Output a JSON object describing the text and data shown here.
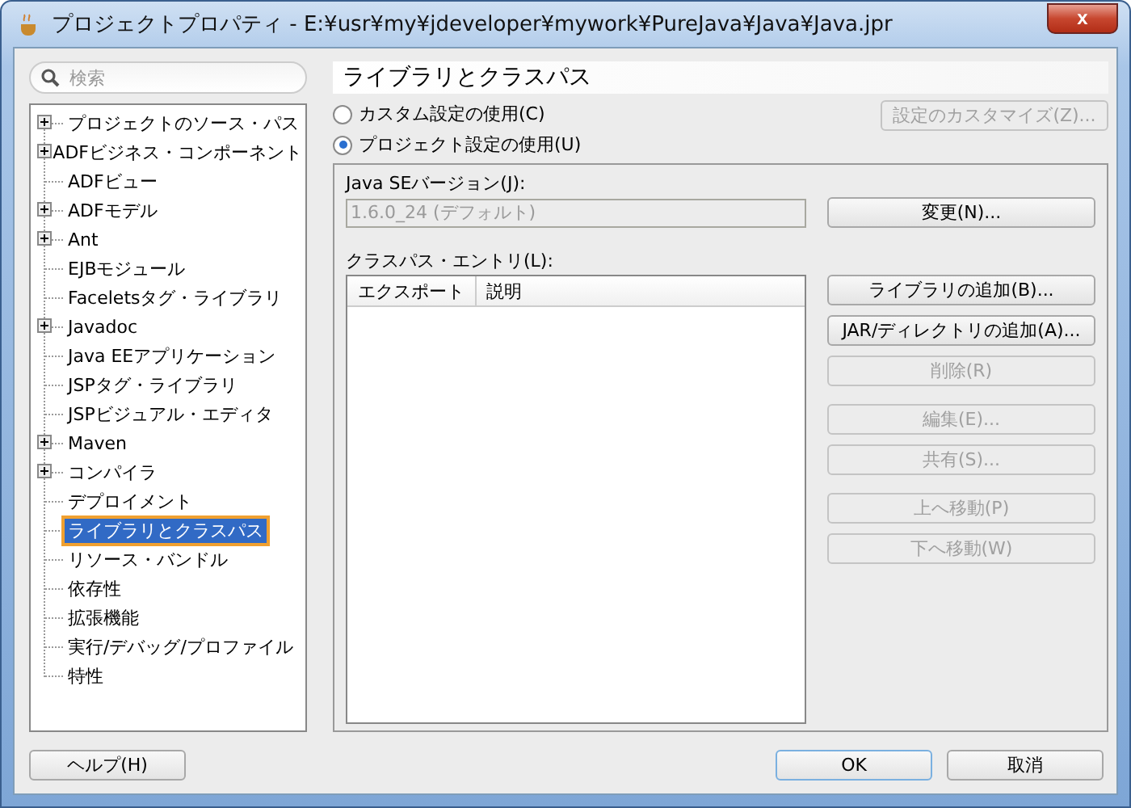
{
  "window": {
    "title": "プロジェクトプロパティ - E:¥usr¥my¥jdeveloper¥mywork¥PureJava¥Java¥Java.jpr",
    "close": "x"
  },
  "search": {
    "placeholder": "検索"
  },
  "tree": [
    {
      "label": "プロジェクトのソース・パス",
      "expandable": true,
      "selected": false
    },
    {
      "label": "ADFビジネス・コンポーネント",
      "expandable": true,
      "selected": false
    },
    {
      "label": "ADFビュー",
      "expandable": false,
      "selected": false
    },
    {
      "label": "ADFモデル",
      "expandable": true,
      "selected": false
    },
    {
      "label": "Ant",
      "expandable": true,
      "selected": false
    },
    {
      "label": "EJBモジュール",
      "expandable": false,
      "selected": false
    },
    {
      "label": "Faceletsタグ・ライブラリ",
      "expandable": false,
      "selected": false
    },
    {
      "label": "Javadoc",
      "expandable": true,
      "selected": false
    },
    {
      "label": "Java EEアプリケーション",
      "expandable": false,
      "selected": false
    },
    {
      "label": "JSPタグ・ライブラリ",
      "expandable": false,
      "selected": false
    },
    {
      "label": "JSPビジュアル・エディタ",
      "expandable": false,
      "selected": false
    },
    {
      "label": "Maven",
      "expandable": true,
      "selected": false
    },
    {
      "label": "コンパイラ",
      "expandable": true,
      "selected": false
    },
    {
      "label": "デプロイメント",
      "expandable": false,
      "selected": false
    },
    {
      "label": "ライブラリとクラスパス",
      "expandable": false,
      "selected": true
    },
    {
      "label": "リソース・バンドル",
      "expandable": false,
      "selected": false
    },
    {
      "label": "依存性",
      "expandable": false,
      "selected": false
    },
    {
      "label": "拡張機能",
      "expandable": false,
      "selected": false
    },
    {
      "label": "実行/デバッグ/プロファイル",
      "expandable": false,
      "selected": false
    },
    {
      "label": "特性",
      "expandable": false,
      "selected": false
    }
  ],
  "panel": {
    "title": "ライブラリとクラスパス",
    "options": [
      {
        "label": "カスタム設定の使用(C)",
        "selected": false
      },
      {
        "label": "プロジェクト設定の使用(U)",
        "selected": true
      }
    ],
    "customize_button": {
      "label": "設定のカスタマイズ(Z)...",
      "disabled": true
    },
    "java_version": {
      "label": "Java SEバージョン(J):",
      "value": "1.6.0_24 (デフォルト)",
      "disabled": true
    },
    "change_button": {
      "label": "変更(N)...",
      "disabled": false
    },
    "classpath": {
      "label": "クラスパス・エントリ(L):",
      "columns": [
        "エクスポート",
        "説明"
      ]
    },
    "button_groups": [
      [
        {
          "label": "ライブラリの追加(B)...",
          "disabled": false
        },
        {
          "label": "JAR/ディレクトリの追加(A)...",
          "disabled": false
        },
        {
          "label": "削除(R)",
          "disabled": true
        }
      ],
      [
        {
          "label": "編集(E)...",
          "disabled": true
        },
        {
          "label": "共有(S)...",
          "disabled": true
        }
      ],
      [
        {
          "label": "上へ移動(P)",
          "disabled": true
        },
        {
          "label": "下へ移動(W)",
          "disabled": true
        }
      ]
    ]
  },
  "footer": {
    "help": "ヘルプ(H)",
    "ok": "OK",
    "cancel": "取消"
  }
}
